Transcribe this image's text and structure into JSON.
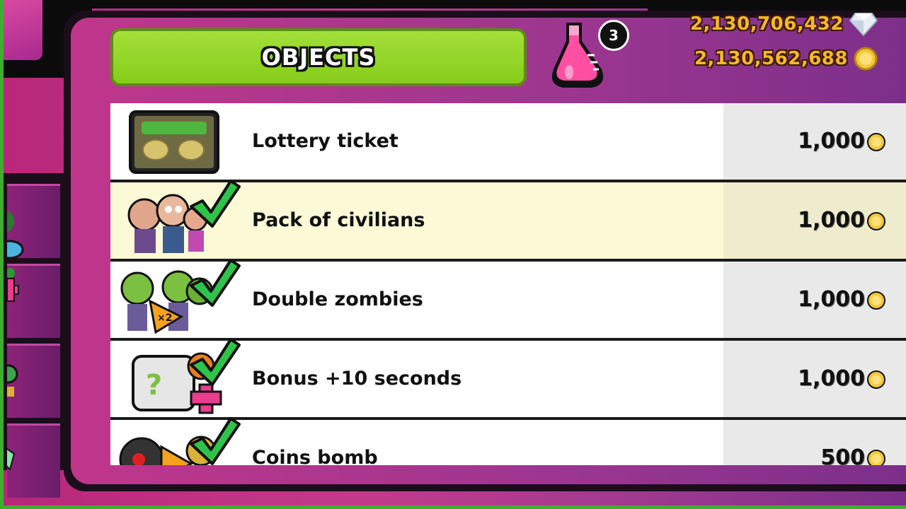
{
  "title": "OBJECTS",
  "flask_count": "3",
  "currency": {
    "diamonds": "2,130,706,432",
    "coins": "2,130,562,688"
  },
  "items": [
    {
      "name": "Lottery ticket",
      "price": "1,000",
      "icon": "lottery-ticket-icon",
      "owned": false,
      "selected": false
    },
    {
      "name": "Pack of civilians",
      "price": "1,000",
      "icon": "civilians-icon",
      "owned": true,
      "selected": true
    },
    {
      "name": "Double zombies",
      "price": "1,000",
      "icon": "double-zombies-icon",
      "owned": true,
      "selected": false
    },
    {
      "name": "Bonus +10 seconds",
      "price": "1,000",
      "icon": "bonus-time-icon",
      "owned": true,
      "selected": false
    },
    {
      "name": "Coins bomb",
      "price": "500",
      "icon": "coins-bomb-icon",
      "owned": true,
      "selected": false
    }
  ],
  "colors": {
    "title_bg": "#97d72a",
    "frame": "#c0368b",
    "currency_text": "#f7b72b",
    "selected_row": "#fcfad6"
  }
}
